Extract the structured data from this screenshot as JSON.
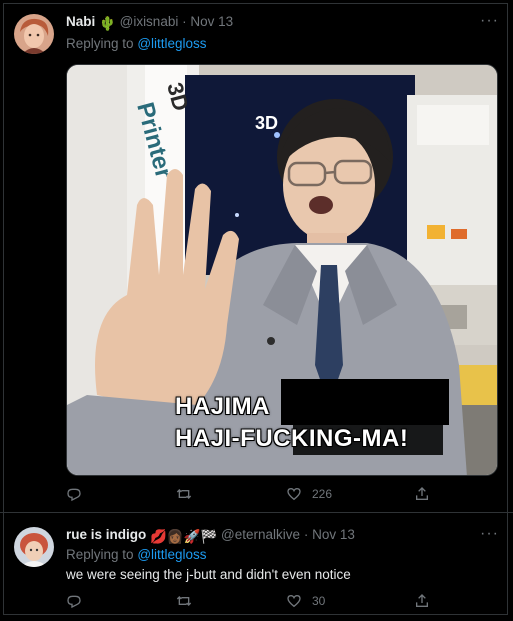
{
  "colors": {
    "background": "#000000",
    "text_primary": "#e7e9ea",
    "text_secondary": "#71767b",
    "link": "#1d9bf0",
    "divider": "#2f3336"
  },
  "tweets": [
    {
      "name": "Nabi",
      "name_emoji": "🌵",
      "handle": "@ixisnabi",
      "separator": "·",
      "date": "Nov 13",
      "replying_prefix": "Replying to",
      "replying_to": "@littlegloss",
      "text": "",
      "media": {
        "caption_line1": "HAJIMA",
        "caption_line2": "HAJI-FUCKING-MA!",
        "sign_text1": "3D",
        "sign_text2": "Printer",
        "sign_text3": "3D"
      },
      "actions": {
        "reply_icon": "reply-icon",
        "retweet_icon": "retweet-icon",
        "like_icon": "like-icon",
        "like_count": "226",
        "share_icon": "share-icon"
      },
      "more_label": "···"
    },
    {
      "name": "rue is indigo",
      "name_emoji": "💋👩🏾🚀🏁",
      "handle": "@eternalkive",
      "separator": "·",
      "date": "Nov 13",
      "replying_prefix": "Replying to",
      "replying_to": "@littlegloss",
      "text": "we were seeing the j-butt and didn't even notice",
      "actions": {
        "reply_icon": "reply-icon",
        "retweet_icon": "retweet-icon",
        "like_icon": "like-icon",
        "like_count": "30",
        "share_icon": "share-icon"
      },
      "more_label": "···"
    }
  ]
}
